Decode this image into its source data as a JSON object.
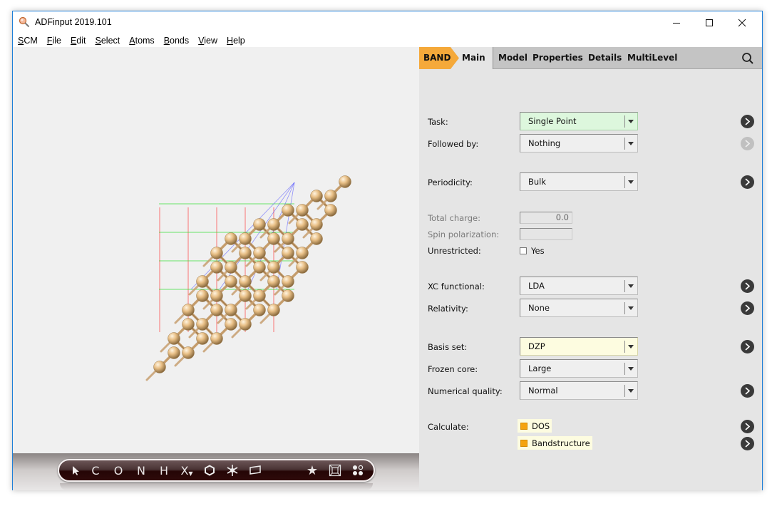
{
  "window": {
    "title": "ADFinput 2019.101",
    "controls": [
      "minimize",
      "maximize",
      "close"
    ]
  },
  "menubar": {
    "items": [
      {
        "label": "SCM",
        "mnemonic": "S",
        "rest": "CM"
      },
      {
        "label": "File",
        "mnemonic": "F",
        "rest": "ile"
      },
      {
        "label": "Edit",
        "mnemonic": "E",
        "rest": "dit"
      },
      {
        "label": "Select",
        "mnemonic": "S",
        "rest": "elect"
      },
      {
        "label": "Atoms",
        "mnemonic": "A",
        "rest": "toms"
      },
      {
        "label": "Bonds",
        "mnemonic": "B",
        "rest": "onds"
      },
      {
        "label": "View",
        "mnemonic": "V",
        "rest": "iew"
      },
      {
        "label": "Help",
        "mnemonic": "H",
        "rest": "elp"
      }
    ]
  },
  "viewer": {
    "structure": "periodic bulk crystal (diamond-like lattice)",
    "atom_color": "#e8bf86",
    "axis_colors": {
      "x": "#ff4040",
      "y": "#30e030",
      "z": "#5050ff"
    }
  },
  "toolbar": {
    "tools": [
      {
        "name": "select-tool",
        "glyph": "arrow"
      },
      {
        "name": "carbon-tool",
        "glyph": "C"
      },
      {
        "name": "oxygen-tool",
        "glyph": "O"
      },
      {
        "name": "nitrogen-tool",
        "glyph": "N"
      },
      {
        "name": "hydrogen-tool",
        "glyph": "H"
      },
      {
        "name": "other-element-tool",
        "glyph": "X"
      },
      {
        "name": "ring-tool",
        "glyph": "hexagon"
      },
      {
        "name": "structure-tool",
        "glyph": "snowflake"
      },
      {
        "name": "plane-tool",
        "glyph": "parallelogram"
      },
      {
        "name": "favorites-tool",
        "glyph": "★"
      },
      {
        "name": "crystal-tool",
        "glyph": "box"
      },
      {
        "name": "view-tool",
        "glyph": "dots"
      }
    ]
  },
  "panel": {
    "tabs": {
      "engine": "BAND",
      "active": "Main",
      "others": [
        "Model",
        "Properties",
        "Details",
        "MultiLevel"
      ]
    },
    "accent": "#f5a93a",
    "fields": {
      "task": {
        "label": "Task:",
        "value": "Single Point"
      },
      "followed_by": {
        "label": "Followed by:",
        "value": "Nothing"
      },
      "periodicity": {
        "label": "Periodicity:",
        "value": "Bulk"
      },
      "total_charge": {
        "label": "Total charge:",
        "value": "0.0"
      },
      "spin_polarization": {
        "label": "Spin polarization:",
        "value": ""
      },
      "unrestricted": {
        "label": "Unrestricted:",
        "option": "Yes",
        "checked": false
      },
      "xc_functional": {
        "label": "XC functional:",
        "value": "LDA"
      },
      "relativity": {
        "label": "Relativity:",
        "value": "None"
      },
      "basis_set": {
        "label": "Basis set:",
        "value": "DZP"
      },
      "frozen_core": {
        "label": "Frozen core:",
        "value": "Large"
      },
      "numerical_quality": {
        "label": "Numerical quality:",
        "value": "Normal"
      },
      "calculate": {
        "label": "Calculate:",
        "items": [
          "DOS",
          "Bandstructure"
        ]
      }
    }
  }
}
